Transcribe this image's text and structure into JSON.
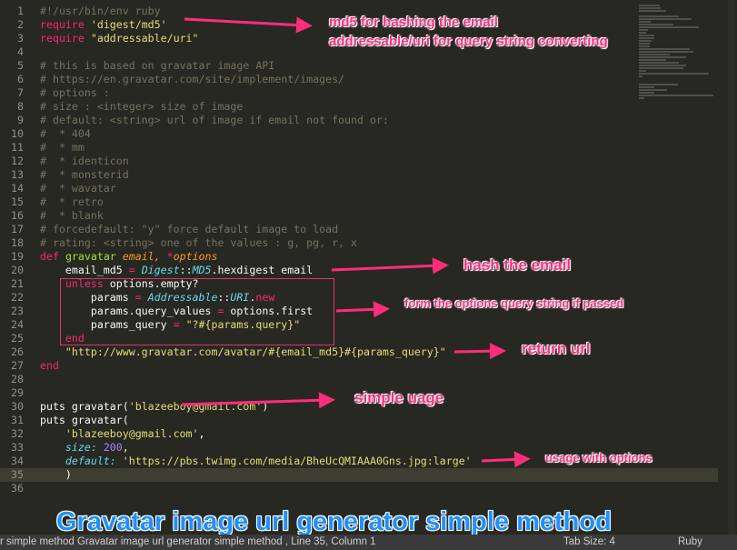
{
  "editor": {
    "current_line": 35,
    "lines": [
      [
        [
          "#!/usr/bin/env ruby",
          "cm"
        ]
      ],
      [
        [
          "require",
          "kw"
        ],
        [
          " ",
          ""
        ],
        [
          "'digest/md5'",
          "str"
        ]
      ],
      [
        [
          "require",
          "kw"
        ],
        [
          " ",
          ""
        ],
        [
          "\"addressable/uri\"",
          "str"
        ]
      ],
      [],
      [
        [
          "# this is based on gravatar image API",
          "cm"
        ]
      ],
      [
        [
          "# https://en.gravatar.com/site/implement/images/",
          "cm"
        ]
      ],
      [
        [
          "# options :",
          "cm"
        ]
      ],
      [
        [
          "# size : <integer> size of image",
          "cm"
        ]
      ],
      [
        [
          "# default: <string> url of image if email not found or:",
          "cm"
        ]
      ],
      [
        [
          "#  * 404",
          "cm"
        ]
      ],
      [
        [
          "#  * mm",
          "cm"
        ]
      ],
      [
        [
          "#  * identicon",
          "cm"
        ]
      ],
      [
        [
          "#  * monsterid",
          "cm"
        ]
      ],
      [
        [
          "#  * wavatar",
          "cm"
        ]
      ],
      [
        [
          "#  * retro",
          "cm"
        ]
      ],
      [
        [
          "#  * blank",
          "cm"
        ]
      ],
      [
        [
          "# forcedefault: \"y\" force default image to load",
          "cm"
        ]
      ],
      [
        [
          "# rating: <string> one of the values : g, pg, r, x",
          "cm"
        ]
      ],
      [
        [
          "def",
          "kw"
        ],
        [
          " ",
          ""
        ],
        [
          "gravatar",
          "fn"
        ],
        [
          " ",
          ""
        ],
        [
          "email, ",
          "arg"
        ],
        [
          "*",
          "kw"
        ],
        [
          "options",
          "arg"
        ]
      ],
      [
        [
          "    email_md5 ",
          ""
        ],
        [
          "=",
          "kw"
        ],
        [
          " ",
          ""
        ],
        [
          "Digest",
          "cls"
        ],
        [
          "::",
          ""
        ],
        [
          "MD5",
          "cls"
        ],
        [
          ".hexdigest email",
          ""
        ]
      ],
      [
        [
          "    ",
          ""
        ],
        [
          "unless",
          "kw"
        ],
        [
          " options.empty?",
          ""
        ]
      ],
      [
        [
          "        params ",
          ""
        ],
        [
          "=",
          "kw"
        ],
        [
          " ",
          ""
        ],
        [
          "Addressable",
          "cls"
        ],
        [
          "::",
          ""
        ],
        [
          "URI",
          "cls"
        ],
        [
          ".",
          ""
        ],
        [
          "new",
          "kw"
        ]
      ],
      [
        [
          "        params.query_values ",
          ""
        ],
        [
          "=",
          "kw"
        ],
        [
          " options.first",
          ""
        ]
      ],
      [
        [
          "        params_query ",
          ""
        ],
        [
          "=",
          "kw"
        ],
        [
          " ",
          ""
        ],
        [
          "\"?#{params.query}\"",
          "str"
        ]
      ],
      [
        [
          "    ",
          ""
        ],
        [
          "end",
          "kw"
        ]
      ],
      [
        [
          "    ",
          ""
        ],
        [
          "\"http://www.gravatar.com/avatar/#{email_md5}#{params_query}\"",
          "str"
        ]
      ],
      [
        [
          "end",
          "kw"
        ]
      ],
      [],
      [],
      [
        [
          "puts gravatar(",
          ""
        ],
        [
          "'blazeeboy@gmail.com'",
          "str"
        ],
        [
          ")",
          ""
        ]
      ],
      [
        [
          "puts gravatar(",
          ""
        ]
      ],
      [
        [
          "    ",
          ""
        ],
        [
          "'blazeeboy@gmail.com'",
          "str"
        ],
        [
          ",",
          ""
        ]
      ],
      [
        [
          "    ",
          ""
        ],
        [
          "size:",
          "cls"
        ],
        [
          " ",
          ""
        ],
        [
          "200",
          "num"
        ],
        [
          ",",
          ""
        ]
      ],
      [
        [
          "    ",
          ""
        ],
        [
          "default:",
          "cls"
        ],
        [
          " ",
          ""
        ],
        [
          "'https://pbs.twimg.com/media/BheUcQMIAAA0Gns.jpg:large'",
          "str"
        ]
      ],
      [
        [
          "    )",
          ""
        ]
      ],
      []
    ]
  },
  "annotations": {
    "requires": [
      "md5 for hashing the email",
      "addressable/uri for query string converting"
    ],
    "hash": "hash the email",
    "options": "form the options query string if passed",
    "return": "return url",
    "simple": "simple uage",
    "usage_options": "usage with options"
  },
  "title": "Gravatar image url generator simple method",
  "statusbar": {
    "left": "r simple method Gravatar image url generator simple method , Line 35, Column 1",
    "tab_size": "Tab Size: 4",
    "syntax": "Ruby"
  },
  "colors": {
    "annotation": "#ff2d7a",
    "title": "#1e90ff",
    "background": "#272822"
  }
}
